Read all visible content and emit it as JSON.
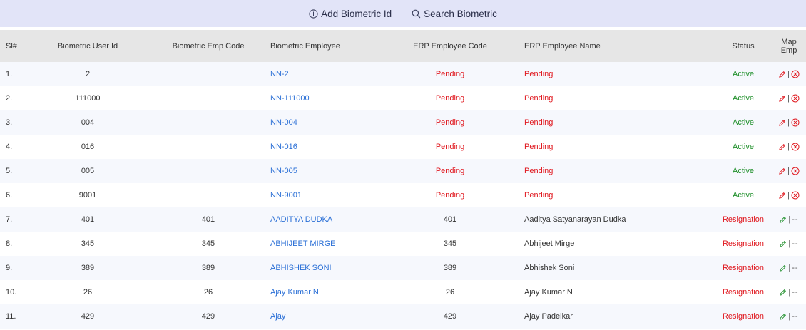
{
  "toolbar": {
    "add_label": "Add Biometric Id",
    "search_label": "Search Biometric"
  },
  "colors": {
    "toolbar_bg": "#e2e4f8",
    "header_bg": "#e6e6e6",
    "link": "#2a6fd6",
    "pending": "#e0181f",
    "active": "#1f8f2a",
    "resignation": "#e0181f"
  },
  "table": {
    "headers": [
      "Sl#",
      "Biometric User Id",
      "Biometric Emp Code",
      "Biometric Employee",
      "ERP Employee Code",
      "ERP Employee Name",
      "Status",
      "Map Emp"
    ],
    "rows": [
      {
        "sl": "1.",
        "user_id": "2",
        "emp_code": "",
        "employee": "NN-2",
        "erp_code": "Pending",
        "erp_name": "Pending",
        "status": "Active",
        "mapped": false
      },
      {
        "sl": "2.",
        "user_id": "111000",
        "emp_code": "",
        "employee": "NN-111000",
        "erp_code": "Pending",
        "erp_name": "Pending",
        "status": "Active",
        "mapped": false
      },
      {
        "sl": "3.",
        "user_id": "004",
        "emp_code": "",
        "employee": "NN-004",
        "erp_code": "Pending",
        "erp_name": "Pending",
        "status": "Active",
        "mapped": false
      },
      {
        "sl": "4.",
        "user_id": "016",
        "emp_code": "",
        "employee": "NN-016",
        "erp_code": "Pending",
        "erp_name": "Pending",
        "status": "Active",
        "mapped": false
      },
      {
        "sl": "5.",
        "user_id": "005",
        "emp_code": "",
        "employee": "NN-005",
        "erp_code": "Pending",
        "erp_name": "Pending",
        "status": "Active",
        "mapped": false
      },
      {
        "sl": "6.",
        "user_id": "9001",
        "emp_code": "",
        "employee": "NN-9001",
        "erp_code": "Pending",
        "erp_name": "Pending",
        "status": "Active",
        "mapped": false
      },
      {
        "sl": "7.",
        "user_id": "401",
        "emp_code": "401",
        "employee": "AADITYA DUDKA",
        "erp_code": "401",
        "erp_name": "Aaditya Satyanarayan Dudka",
        "status": "Resignation",
        "mapped": true
      },
      {
        "sl": "8.",
        "user_id": "345",
        "emp_code": "345",
        "employee": "ABHIJEET MIRGE",
        "erp_code": "345",
        "erp_name": "Abhijeet Mirge",
        "status": "Resignation",
        "mapped": true
      },
      {
        "sl": "9.",
        "user_id": "389",
        "emp_code": "389",
        "employee": "ABHISHEK SONI",
        "erp_code": "389",
        "erp_name": "Abhishek Soni",
        "status": "Resignation",
        "mapped": true
      },
      {
        "sl": "10.",
        "user_id": "26",
        "emp_code": "26",
        "employee": "Ajay Kumar N",
        "erp_code": "26",
        "erp_name": "Ajay Kumar N",
        "status": "Resignation",
        "mapped": true
      },
      {
        "sl": "11.",
        "user_id": "429",
        "emp_code": "429",
        "employee": "Ajay",
        "erp_code": "429",
        "erp_name": "Ajay Padelkar",
        "status": "Resignation",
        "mapped": true
      }
    ],
    "separator": "|",
    "no_delete_text": "--"
  }
}
